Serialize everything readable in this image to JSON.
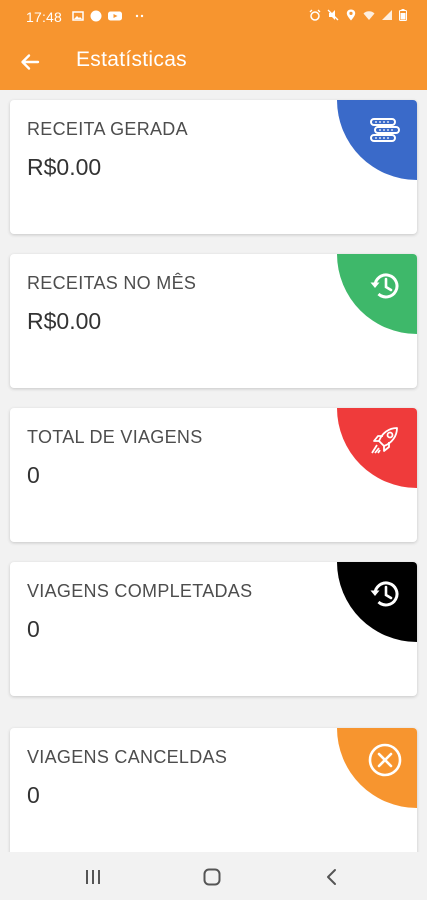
{
  "status_bar": {
    "time": "17:48",
    "icons": [
      "gallery-icon",
      "circle-icon",
      "youtube-icon",
      "dots-icon",
      "alarm-icon",
      "mute-icon",
      "location-icon",
      "wifi-icon",
      "signal-icon",
      "battery-icon"
    ]
  },
  "header": {
    "title": "Estatísticas",
    "back_icon": "arrow-left-icon",
    "background": "#f7952f"
  },
  "cards": [
    {
      "label": "RECEITA GERADA",
      "value": "R$0.00",
      "icon": "coins-stack-icon",
      "color": "#3a6ac9"
    },
    {
      "label": "RECEITAS NO MÊS",
      "value": "R$0.00",
      "icon": "history-icon",
      "color": "#3eb86a"
    },
    {
      "label": "TOTAL DE VIAGENS",
      "value": "0",
      "icon": "rocket-icon",
      "color": "#ef3b3b"
    },
    {
      "label": "VIAGENS COMPLETADAS",
      "value": "0",
      "icon": "history-icon",
      "color": "#000000"
    },
    {
      "label": "VIAGENS CANCELDAS",
      "value": "0",
      "icon": "cancel-circle-icon",
      "color": "#f7952f"
    }
  ],
  "nav_bar": {
    "buttons": [
      "recent-apps-icon",
      "home-icon",
      "back-icon"
    ]
  }
}
